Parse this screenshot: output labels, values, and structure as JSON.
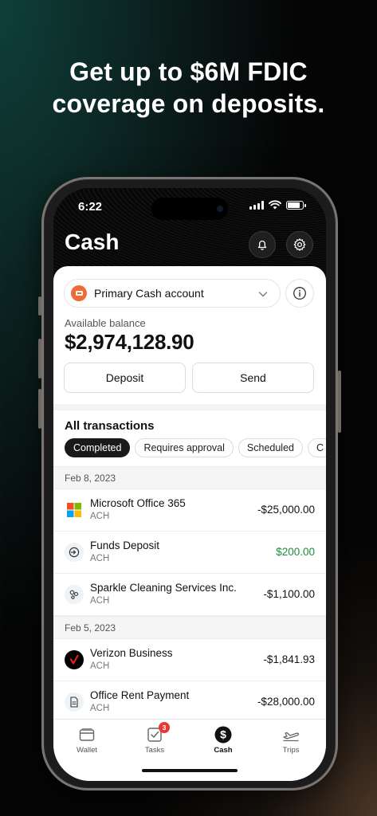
{
  "headline": {
    "line1": "Get up to $6M FDIC",
    "line2": "coverage on deposits."
  },
  "status_bar": {
    "time": "6:22",
    "battery_level": 0.85
  },
  "header": {
    "title": "Cash",
    "bell_icon": "bell-icon",
    "settings_icon": "gear-icon"
  },
  "account": {
    "name": "Primary Cash account",
    "logo_color": "#f06a35",
    "balance_label": "Available balance",
    "balance": "$2,974,128.90"
  },
  "actions": {
    "deposit": "Deposit",
    "send": "Send"
  },
  "transactions": {
    "title": "All transactions",
    "filters": [
      "Completed",
      "Requires approval",
      "Scheduled",
      "C"
    ],
    "active_filter": "Completed",
    "groups": [
      {
        "date": "Feb 8, 2023",
        "items": [
          {
            "name": "Microsoft Office 365",
            "method": "ACH",
            "amount": "-$25,000.00",
            "icon": "microsoft-logo"
          },
          {
            "name": "Funds Deposit",
            "method": "ACH",
            "amount": "$200.00",
            "icon": "deposit-icon"
          },
          {
            "name": "Sparkle Cleaning Services Inc.",
            "method": "ACH",
            "amount": "-$1,100.00",
            "icon": "bubbles-icon"
          }
        ]
      },
      {
        "date": "Feb 5, 2023",
        "items": [
          {
            "name": "Verizon Business",
            "method": "ACH",
            "amount": "-$1,841.93",
            "icon": "verizon-logo"
          },
          {
            "name": "Office Rent Payment",
            "method": "ACH",
            "amount": "-$28,000.00",
            "icon": "document-icon"
          }
        ]
      }
    ]
  },
  "tabbar": {
    "tabs": [
      {
        "label": "Wallet",
        "icon": "wallet-icon"
      },
      {
        "label": "Tasks",
        "icon": "tasks-icon",
        "badge": "3"
      },
      {
        "label": "Cash",
        "icon": "dollar-icon"
      },
      {
        "label": "Trips",
        "icon": "plane-icon"
      }
    ],
    "active": "Cash"
  },
  "colors": {
    "positive": "#1e8c3a",
    "badge": "#e53935",
    "accent_dark": "#1a1a1a"
  }
}
